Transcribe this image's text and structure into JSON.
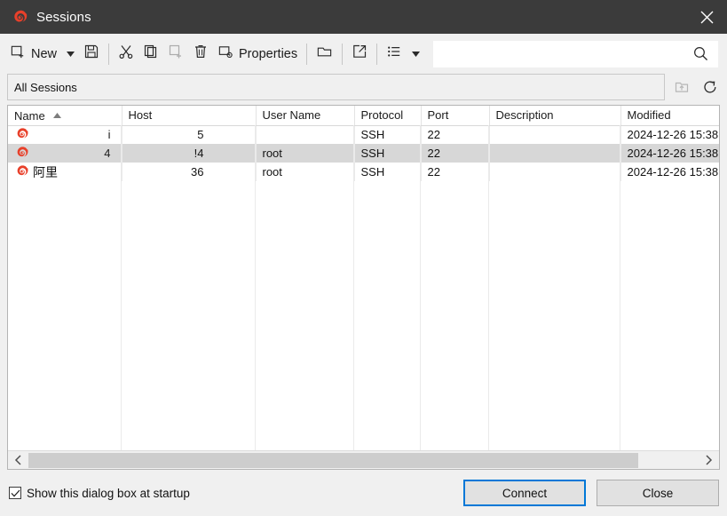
{
  "window": {
    "title": "Sessions",
    "logo_icon": "mobaxterm-spiral-icon",
    "close_icon": "close-icon"
  },
  "toolbar": {
    "new_label": "New",
    "new_icon": "new-session-icon",
    "new_dropdown_icon": "chevron-down-icon",
    "save_icon": "save-icon",
    "cut_icon": "cut-scissors-icon",
    "copy_icon": "copy-icon",
    "paste_icon": "paste-icon",
    "delete_icon": "trash-icon",
    "properties_label": "Properties",
    "properties_icon": "properties-gear-icon",
    "open_folder_icon": "open-folder-icon",
    "export_icon": "export-external-link-icon",
    "list_view_icon": "list-view-icon",
    "view_dropdown_icon": "chevron-down-icon",
    "search_value": "",
    "search_placeholder": "",
    "search_icon": "search-icon"
  },
  "path_bar": {
    "text": "All Sessions",
    "up_folder_icon": "folder-up-icon",
    "refresh_icon": "refresh-icon"
  },
  "table": {
    "columns": [
      {
        "label": "Name",
        "sorted": true,
        "sort_icon": "sort-ascending-icon"
      },
      {
        "label": "Host",
        "sorted": false
      },
      {
        "label": "User Name",
        "sorted": false
      },
      {
        "label": "Protocol",
        "sorted": false
      },
      {
        "label": "Port",
        "sorted": false
      },
      {
        "label": "Description",
        "sorted": false
      },
      {
        "label": "Modified",
        "sorted": false
      }
    ],
    "rows": [
      {
        "icon": "session-spiral-icon",
        "name": "i",
        "host": "5",
        "user_name": "",
        "protocol": "SSH",
        "port": "22",
        "description": "",
        "modified": "2024-12-26 15:38",
        "selected": false
      },
      {
        "icon": "session-spiral-icon",
        "name": "4",
        "host": "!4",
        "user_name": "root",
        "protocol": "SSH",
        "port": "22",
        "description": "",
        "modified": "2024-12-26 15:38",
        "selected": true
      },
      {
        "icon": "session-spiral-icon",
        "name": "阿里",
        "host": "36",
        "user_name": "root",
        "protocol": "SSH",
        "port": "22",
        "description": "",
        "modified": "2024-12-26 15:38",
        "selected": false
      }
    ]
  },
  "scrollbar": {
    "left_arrow_icon": "chevron-left-icon",
    "right_arrow_icon": "chevron-right-icon"
  },
  "footer": {
    "checkbox_label": "Show this dialog box at startup",
    "checkbox_checked": true,
    "check_icon": "check-icon",
    "connect_label": "Connect",
    "close_label": "Close"
  },
  "colors": {
    "titlebar_bg": "#3b3b3b",
    "chrome_bg": "#f0f0f0",
    "accent_blue": "#0078d7",
    "logo_red": "#e8402a",
    "selection_gray": "#d7d7d7"
  }
}
